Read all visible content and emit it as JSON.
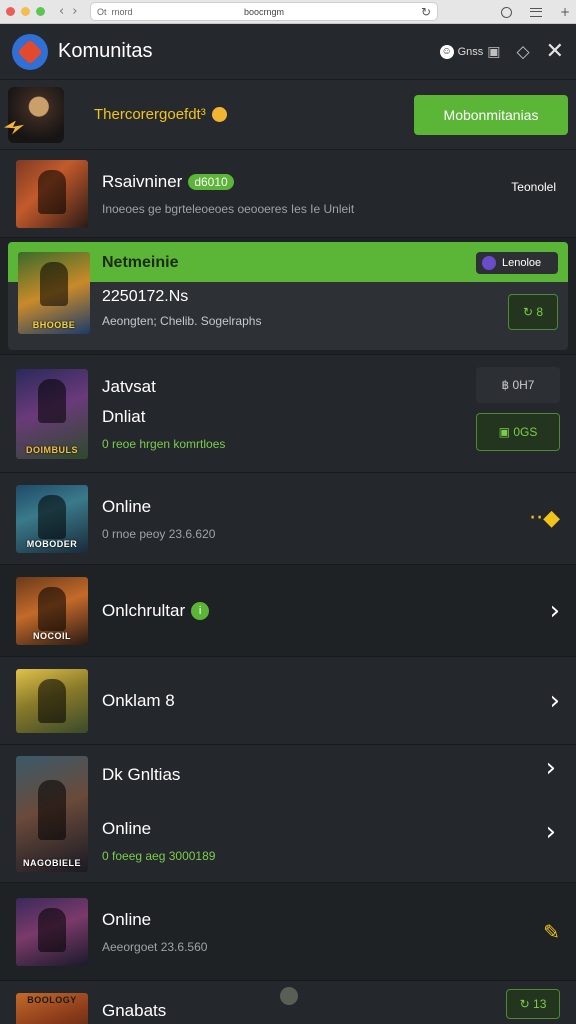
{
  "browser": {
    "tab_text": "Ot",
    "tab_extra": "rnord",
    "address": "boocrngm",
    "reload_icon": "reload-icon",
    "colors": {
      "close": "#ed5f56",
      "minimize": "#f4be4f",
      "maximize": "#5fc454"
    }
  },
  "header": {
    "title": "Komunitas",
    "pill_label": "Gnss",
    "icons": [
      "smile-icon",
      "bag-icon",
      "tag-icon",
      "close-icon"
    ]
  },
  "banner": {
    "text": "Thercorergoefdt³",
    "button_label": "Mobonmitanias",
    "accent_color": "#5bb537"
  },
  "rows": [
    {
      "name": "Rsaivniner",
      "badge": "d6010",
      "sub": "Inoeoes ge bgrteleoeoes oeooeres Ies Ie Unleit",
      "right": "Teonolel",
      "thumb_caption": ""
    },
    {
      "name": "Netmeinie",
      "main": "2250172.Ns",
      "sub": "Aeongten; Chelib. Sogelraphs",
      "tag": "Lenoloe",
      "button": "↻ 8",
      "thumb_caption": "BHOOBE"
    },
    {
      "name": "Jatvsat",
      "name2": "Dnliat",
      "sub": "0 reoe hrgen komrtloes",
      "button_top": "฿ 0H7",
      "button_bottom": "▣ 0GS",
      "thumb_caption": "DOIMBULS"
    },
    {
      "name": "Online",
      "sub": "0 rnoe peoy 23.6.620",
      "right_icon": "diamond-icon",
      "thumb_caption": "MOBODER"
    },
    {
      "name": "Onlchrultar",
      "sub": "",
      "thumb_caption": "NOCOIL"
    },
    {
      "name": "Onklam 8",
      "sub": "",
      "thumb_caption": ""
    },
    {
      "name": "Dk Gnltias",
      "name2": "Online",
      "sub": "0 foeeg aeg 3000189",
      "thumb_caption": "NAGOBIELE"
    },
    {
      "name": "Online",
      "sub": "Aeeorgoet 23.6.560",
      "right_icon": "pencil-icon",
      "thumb_caption": ""
    },
    {
      "name": "Gnabats",
      "sub": "",
      "button": "↻ 13",
      "thumb_caption": "BOOLOGY"
    }
  ]
}
